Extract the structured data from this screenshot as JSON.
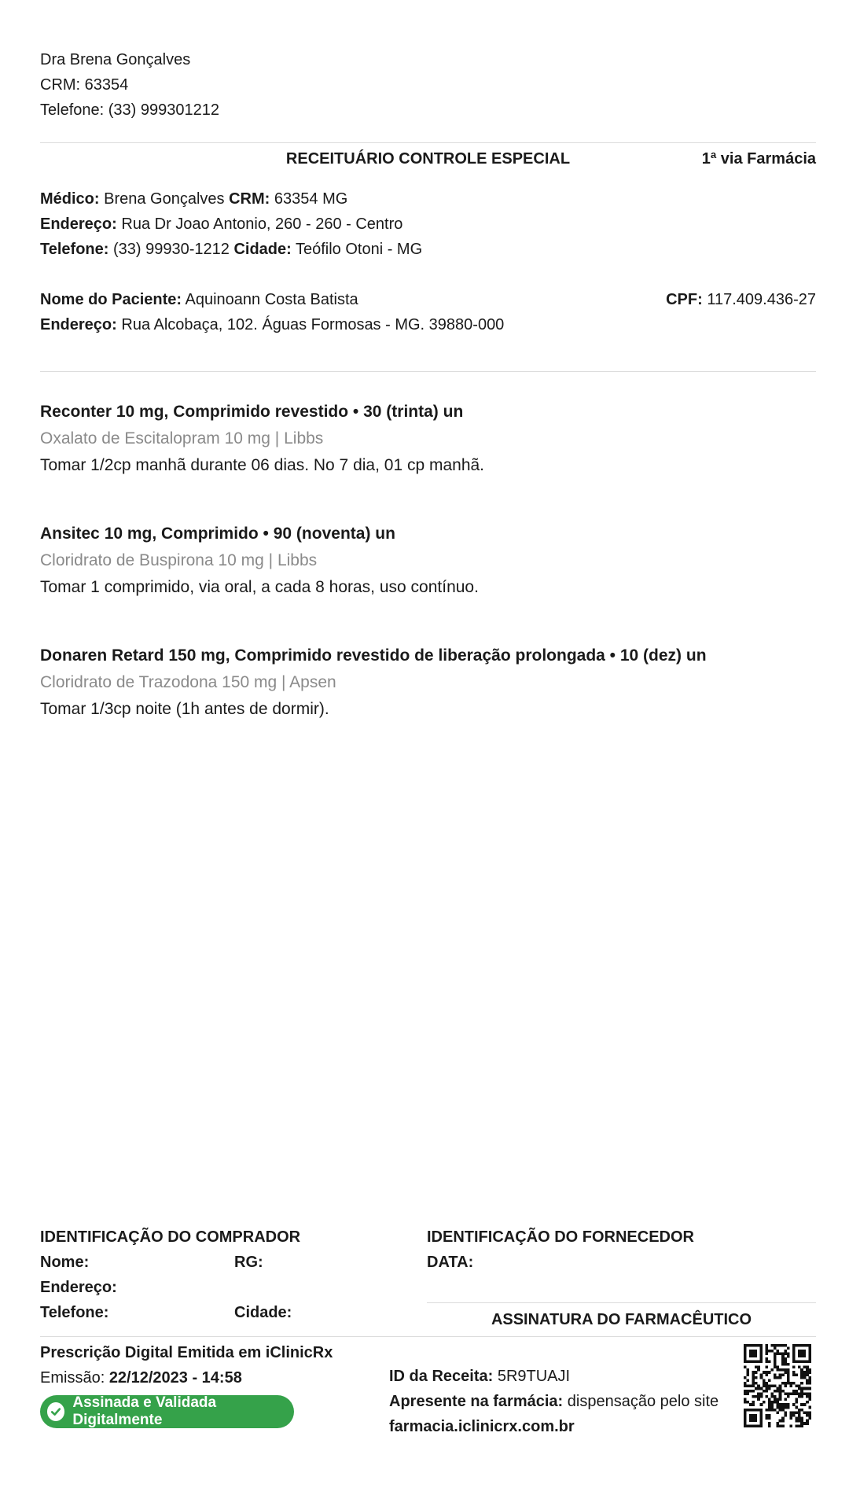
{
  "doctor_header": {
    "name": "Dra Brena Gonçalves",
    "crm": "CRM: 63354",
    "phone": "Telefone: (33) 999301212"
  },
  "prescription": {
    "title": "RECEITUÁRIO CONTROLE ESPECIAL",
    "via": "1ª via Farmácia"
  },
  "medico": {
    "label": "Médico:",
    "name": "Brena Gonçalves",
    "crm_label": "CRM:",
    "crm": "63354 MG",
    "address_label": "Endereço:",
    "address": "Rua Dr Joao Antonio, 260 - 260 - Centro",
    "phone_label": "Telefone:",
    "phone": "(33) 99930-1212",
    "city_label": "Cidade:",
    "city": "Teófilo Otoni - MG"
  },
  "patient": {
    "name_label": "Nome do Paciente:",
    "name": "Aquinoann Costa Batista",
    "address_label": "Endereço:",
    "address": "Rua Alcobaça, 102. Águas Formosas - MG. 39880-000",
    "cpf_label": "CPF:",
    "cpf": "117.409.436-27"
  },
  "medications": [
    {
      "name": "Reconter 10 mg, Comprimido revestido • 30 (trinta) un",
      "generic": "Oxalato de Escitalopram 10 mg | Libbs",
      "instructions": "Tomar 1/2cp manhã durante 06 dias. No 7 dia, 01 cp manhã."
    },
    {
      "name": "Ansitec 10 mg, Comprimido • 90 (noventa) un",
      "generic": "Cloridrato de Buspirona 10 mg | Libbs",
      "instructions": "Tomar 1 comprimido, via oral, a cada 8 horas, uso contínuo."
    },
    {
      "name": "Donaren Retard 150 mg, Comprimido revestido de liberação prolongada • 10 (dez) un",
      "generic": "Cloridrato de Trazodona 150 mg | Apsen",
      "instructions": "Tomar 1/3cp noite (1h antes de dormir)."
    }
  ],
  "buyer": {
    "title": "IDENTIFICAÇÃO DO COMPRADOR",
    "name_label": "Nome:",
    "rg_label": "RG:",
    "address_label": "Endereço:",
    "phone_label": "Telefone:",
    "city_label": "Cidade:"
  },
  "supplier": {
    "title": "IDENTIFICAÇÃO DO FORNECEDOR",
    "date_label": "DATA:",
    "signature_label": "ASSINATURA DO FARMACÊUTICO"
  },
  "footer": {
    "issued_title": "Prescrição Digital Emitida em iClinicRx",
    "emission_label": "Emissão:",
    "emission_value": "22/12/2023 - 14:58",
    "badge": "Assinada e Validada Digitalmente",
    "badge_color": "#35a24a",
    "id_label": "ID da Receita:",
    "id_value": "5R9TUAJI",
    "present_label": "Apresente na farmácia:",
    "present_text": "dispensação pelo site",
    "site": "farmacia.iclinicrx.com.br",
    "qr_icon": "qr-code-icon"
  }
}
